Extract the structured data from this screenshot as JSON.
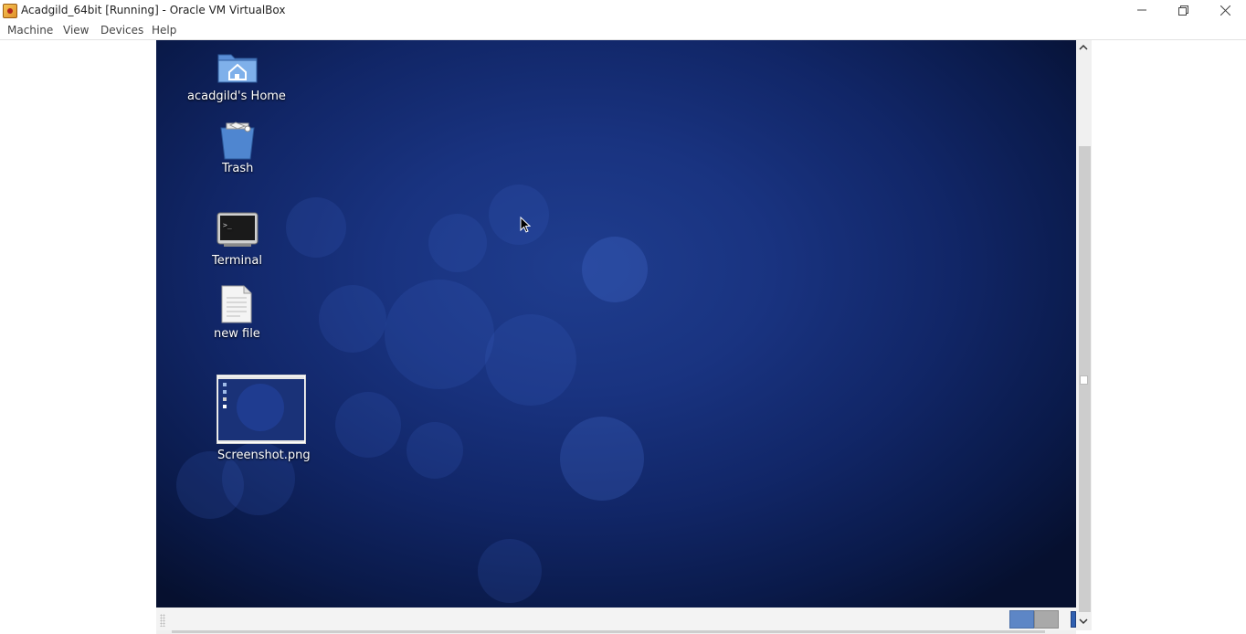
{
  "window": {
    "title": "Acadgild_64bit [Running] - Oracle VM VirtualBox",
    "app_icon": "virtualbox-icon"
  },
  "menu": {
    "items": [
      "Machine",
      "View",
      "Devices",
      "Help"
    ]
  },
  "desktop": {
    "icons": [
      {
        "label": "acadgild's Home",
        "icon": "home-folder-icon"
      },
      {
        "label": "Trash",
        "icon": "trash-icon"
      },
      {
        "label": "Terminal",
        "icon": "terminal-icon"
      },
      {
        "label": "new file",
        "icon": "text-file-icon"
      },
      {
        "label": "Screenshot.png",
        "icon": "image-thumbnail-icon"
      }
    ]
  },
  "colors": {
    "wallpaper": "#193380",
    "status_blue": "#5d86c6",
    "status_gray": "#a9a9a9"
  }
}
